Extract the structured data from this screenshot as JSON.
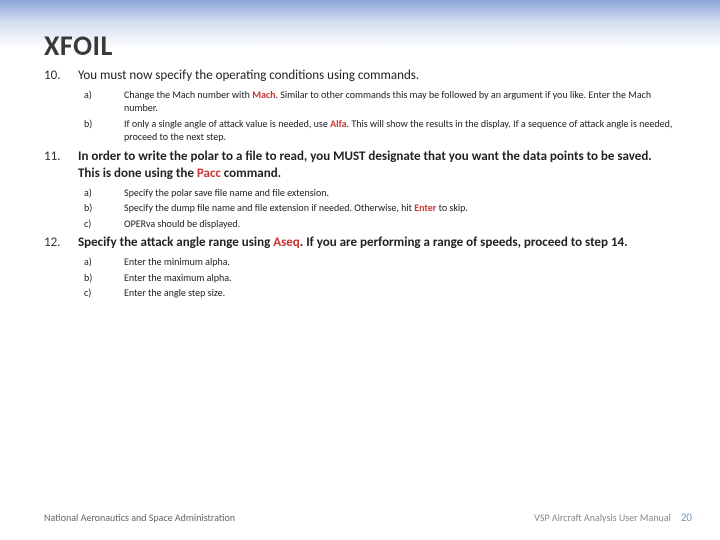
{
  "title": "XFOIL",
  "items": [
    {
      "num": "10.",
      "text_before": "You must now specify the operating conditions using commands.",
      "bold": false,
      "subs": [
        {
          "label": "a)",
          "pre": "Change the Mach number with ",
          "cmd": "Mach",
          "post": ". Similar to other commands this may be followed by an argument if you like. Enter the Mach number."
        },
        {
          "label": "b)",
          "pre": "If only a single angle of attack value is needed, use ",
          "cmd": "Alfa",
          "post": ". This will show the results in the display. If a sequence of attack angle is needed, proceed to the next step."
        }
      ]
    },
    {
      "num": "11.",
      "bold": true,
      "text_pre": "In order to write the polar to a file to read, you MUST designate that you want the data points to be saved. This is done using the ",
      "cmd": "Pacc",
      "text_post": " command.",
      "subs": [
        {
          "label": "a)",
          "pre": "Specify the polar save file name and file extension.",
          "cmd": "",
          "post": ""
        },
        {
          "label": "b)",
          "pre": "Specify the dump file name and file extension if needed. Otherwise, hit ",
          "cmd": "",
          "hit": "Enter",
          "post": " to skip."
        },
        {
          "label": "c)",
          "pre": "OPERva should be displayed.",
          "cmd": "",
          "post": ""
        }
      ]
    },
    {
      "num": "12.",
      "bold": true,
      "text_pre": "Specify the attack angle range using ",
      "cmd": "Aseq",
      "text_post": ". If you are performing a range of speeds, proceed to step 14.",
      "subs": [
        {
          "label": "a)",
          "pre": "Enter the minimum alpha.",
          "cmd": "",
          "post": ""
        },
        {
          "label": "b)",
          "pre": "Enter the maximum alpha.",
          "cmd": "",
          "post": ""
        },
        {
          "label": "c)",
          "pre": "Enter the angle step size.",
          "cmd": "",
          "post": ""
        }
      ]
    }
  ],
  "footer": {
    "left": "National Aeronautics and Space Administration",
    "right": "VSP Aircraft Analysis User Manual",
    "page": "20"
  }
}
